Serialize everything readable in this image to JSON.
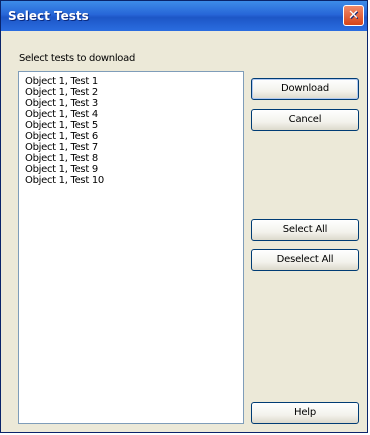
{
  "window": {
    "title": "Select Tests",
    "close_label": "✕"
  },
  "prompt": "Select tests to download",
  "tests": [
    "Object 1, Test 1",
    "Object 1, Test 2",
    "Object 1, Test 3",
    "Object 1, Test 4",
    "Object 1, Test 5",
    "Object 1, Test 6",
    "Object 1, Test 7",
    "Object 1, Test 8",
    "Object 1, Test 9",
    "Object 1, Test 10"
  ],
  "buttons": {
    "download": "Download",
    "cancel": "Cancel",
    "select_all": "Select All",
    "deselect_all": "Deselect All",
    "help": "Help"
  },
  "colors": {
    "titlebar": "#2766d8",
    "close": "#d64418",
    "dialog_bg": "#ece9d8",
    "list_border": "#7f9db9"
  }
}
